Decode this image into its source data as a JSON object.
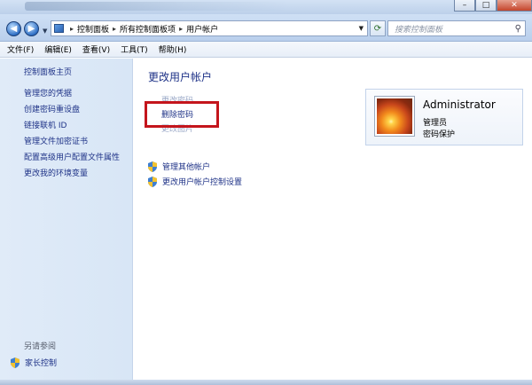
{
  "address": {
    "crumbs": [
      "控制面板",
      "所有控制面板项",
      "用户帐户"
    ]
  },
  "search": {
    "placeholder": "搜索控制面板"
  },
  "menu": {
    "items": [
      "文件(F)",
      "编辑(E)",
      "查看(V)",
      "工具(T)",
      "帮助(H)"
    ]
  },
  "sidebar": {
    "home": "控制面板主页",
    "links": [
      "管理您的凭据",
      "创建密码重设盘",
      "链接联机 ID",
      "管理文件加密证书",
      "配置高级用户配置文件属性",
      "更改我的环境变量"
    ],
    "see_also": "另请参阅",
    "parental": "家长控制"
  },
  "main": {
    "title": "更改用户帐户",
    "tasks": [
      "更改密码",
      "删除密码",
      "更改图片"
    ],
    "admin_links": [
      "管理其他帐户",
      "更改用户帐户控制设置"
    ]
  },
  "user": {
    "name": "Administrator",
    "role": "管理员",
    "protection": "密码保护"
  },
  "colors": {
    "link": "#1e3287",
    "highlight_border": "#c4151c",
    "sidebar_bg": "#dbe8f7"
  }
}
